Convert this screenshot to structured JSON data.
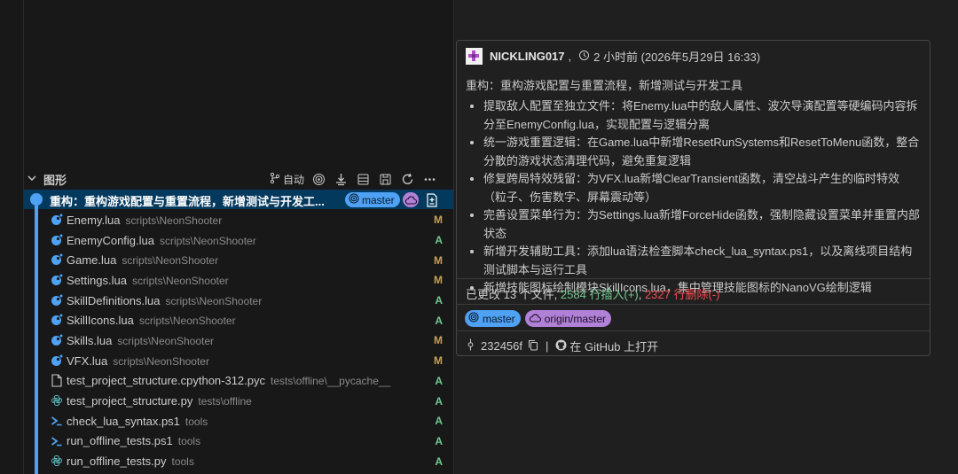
{
  "graph": {
    "title": "图形",
    "auto_label": "自动",
    "icons": [
      "source-control-icon",
      "target-icon",
      "fetch-icon",
      "stash-icon",
      "save-icon",
      "refresh-icon",
      "more-icon"
    ]
  },
  "commit": {
    "message": "重构：重构游戏配置与重置流程，新增测试与开发工...",
    "branch": "master"
  },
  "files": [
    {
      "name": "Enemy.lua",
      "path": "scripts\\NeonShooter",
      "status": "M",
      "type": "lua"
    },
    {
      "name": "EnemyConfig.lua",
      "path": "scripts\\NeonShooter",
      "status": "A",
      "type": "lua"
    },
    {
      "name": "Game.lua",
      "path": "scripts\\NeonShooter",
      "status": "M",
      "type": "lua"
    },
    {
      "name": "Settings.lua",
      "path": "scripts\\NeonShooter",
      "status": "M",
      "type": "lua"
    },
    {
      "name": "SkillDefinitions.lua",
      "path": "scripts\\NeonShooter",
      "status": "A",
      "type": "lua"
    },
    {
      "name": "SkillIcons.lua",
      "path": "scripts\\NeonShooter",
      "status": "A",
      "type": "lua"
    },
    {
      "name": "Skills.lua",
      "path": "scripts\\NeonShooter",
      "status": "M",
      "type": "lua"
    },
    {
      "name": "VFX.lua",
      "path": "scripts\\NeonShooter",
      "status": "M",
      "type": "lua"
    },
    {
      "name": "test_project_structure.cpython-312.pyc",
      "path": "tests\\offline\\__pycache__",
      "status": "A",
      "type": "file"
    },
    {
      "name": "test_project_structure.py",
      "path": "tests\\offline",
      "status": "A",
      "type": "py"
    },
    {
      "name": "check_lua_syntax.ps1",
      "path": "tools",
      "status": "A",
      "type": "ps1"
    },
    {
      "name": "run_offline_tests.ps1",
      "path": "tools",
      "status": "A",
      "type": "ps1"
    },
    {
      "name": "run_offline_tests.py",
      "path": "tools",
      "status": "A",
      "type": "py"
    }
  ],
  "hover": {
    "author": "NICKLING017",
    "author_sep": ",",
    "time": "2 小时前 (2026年5月29日 16:33)",
    "subject": "重构：重构游戏配置与重置流程，新增测试与开发工具",
    "bullets": [
      "提取敌人配置至独立文件：将Enemy.lua中的敌人属性、波次导演配置等硬编码内容拆分至EnemyConfig.lua，实现配置与逻辑分离",
      "统一游戏重置逻辑：在Game.lua中新增ResetRunSystems和ResetToMenu函数，整合分散的游戏状态清理代码，避免重复逻辑",
      "修复跨局特效残留：为VFX.lua新增ClearTransient函数，清空战斗产生的临时特效（粒子、伤害数字、屏幕震动等）",
      "完善设置菜单行为：为Settings.lua新增ForceHide函数，强制隐藏设置菜单并重置内部状态",
      "新增开发辅助工具：添加lua语法检查脚本check_lua_syntax.ps1，以及离线项目结构测试脚本与运行工具",
      "新增技能图标绘制模块SkillIcons.lua，集中管理技能图标的NanoVG绘制逻辑"
    ],
    "stats_prefix": "已更改 13 个文件, ",
    "insertions": "2584 行插入(+)",
    "stats_mid": ", ",
    "deletions": "2327 行删除(-)",
    "badge_master": "master",
    "badge_origin": "origin/master",
    "sha": "232456f",
    "divider": "|",
    "open_github": "在 GitHub 上打开"
  },
  "colors": {
    "accent_blue": "#4ea1f3",
    "accent_purple": "#b180d7",
    "modified": "#c5a05a",
    "added": "#73c991",
    "insertions": "#73c991",
    "deletions": "#f14c4c",
    "lua_icon": "#4ea1f3"
  }
}
